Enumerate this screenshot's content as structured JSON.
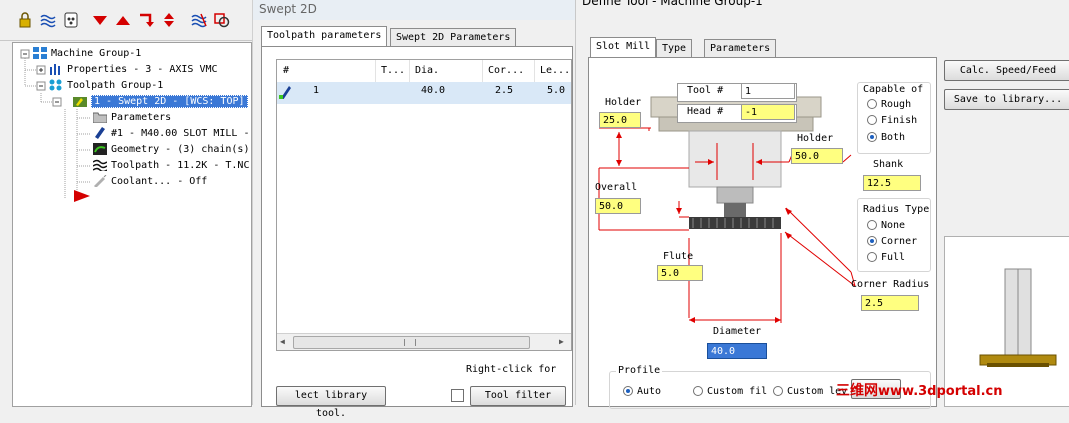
{
  "toolbar": {
    "icons": [
      "lock-icon",
      "wave-icon",
      "ghost-icon",
      "triangle-down-icon",
      "triangle-up-icon",
      "return-arrow-icon",
      "up-down-icon",
      "wave-select-icon",
      "shape-icon"
    ]
  },
  "tree": {
    "items": [
      {
        "label": "Machine Group-1"
      },
      {
        "label": "Properties - 3 - AXIS VMC"
      },
      {
        "label": "Toolpath Group-1"
      },
      {
        "label": "1 - Swept 2D - [WCS: TOP]"
      },
      {
        "label": "Parameters"
      },
      {
        "label": "#1 - M40.00 SLOT MILL -"
      },
      {
        "label": "Geometry - (3) chain(s)"
      },
      {
        "label": "Toolpath - 11.2K - T.NC"
      },
      {
        "label": "Coolant... - Off"
      }
    ]
  },
  "swept": {
    "title": "Swept 2D",
    "tabs": [
      "Toolpath parameters",
      "Swept 2D Parameters"
    ],
    "table": {
      "headers": [
        "#",
        "T...",
        "Dia.",
        "Cor...",
        "Le..."
      ],
      "rows": [
        [
          "1",
          "",
          "40.0",
          "2.5",
          "5.0"
        ]
      ]
    },
    "hint": "Right-click for",
    "select_library_label": "lect library tool.",
    "tool_filter_label": "Tool filter"
  },
  "define": {
    "title": "Define Tool - Machine Group-1",
    "tabs": [
      "Slot Mill",
      "Type",
      "Parameters"
    ],
    "tool_label": "Tool #",
    "tool_value": "1",
    "head_label": "Head #",
    "head_value": "-1",
    "holder_label": "Holder",
    "holder_value": "25.0",
    "holder2_label": "Holder",
    "holder2_value": "50.0",
    "overall_label": "Overall",
    "overall_value": "50.0",
    "shank_label": "Shank",
    "shank_value": "12.5",
    "flute_label": "Flute",
    "flute_value": "5.0",
    "diameter_label": "Diameter",
    "diameter_value": "40.0",
    "capable_title": "Capable of",
    "capable_options": [
      "Rough",
      "Finish",
      "Both"
    ],
    "capable_selected": "Both",
    "radius_type_title": "Radius Type",
    "radius_options": [
      "None",
      "Corner",
      "Full"
    ],
    "radius_selected": "Corner",
    "corner_radius_label": "Corner Radius",
    "corner_radius_value": "2.5",
    "profile_title": "Profile",
    "profile_options": [
      "Auto",
      "Custom fil",
      "Custom lev"
    ],
    "profile_selected": "Auto",
    "calc_button": "Calc. Speed/Feed",
    "save_button": "Save to library..."
  },
  "watermark": {
    "chinese": "三维网",
    "site": "www.3dportal.cn"
  }
}
